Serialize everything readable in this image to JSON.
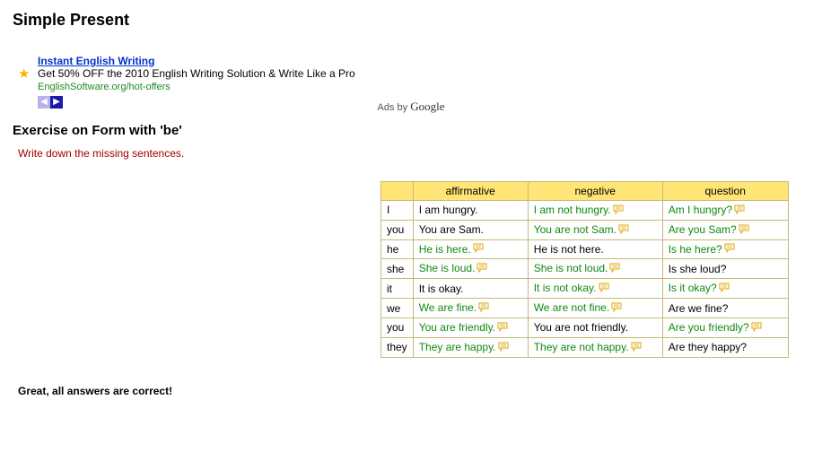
{
  "page_title": "Simple Present",
  "ad": {
    "title": "Instant English Writing",
    "body": "Get 50% OFF the 2010 English Writing Solution & Write Like a Pro",
    "url": "EnglishSoftware.org/hot-offers"
  },
  "ads_by_prefix": "Ads by ",
  "ads_by_brand": "Google",
  "subtitle": "Exercise on Form with 'be'",
  "instruction": "Write down the missing sentences.",
  "headers": {
    "affirmative": "affirmative",
    "negative": "negative",
    "question": "question"
  },
  "rows": [
    {
      "pron": "I",
      "aff": {
        "t": "I am hungry.",
        "ans": false,
        "b": false
      },
      "neg": {
        "t": "I am not hungry.",
        "ans": true,
        "b": true
      },
      "que": {
        "t": "Am I hungry?",
        "ans": true,
        "b": true
      }
    },
    {
      "pron": "you",
      "aff": {
        "t": "You are Sam.",
        "ans": false,
        "b": false
      },
      "neg": {
        "t": "You are not Sam.",
        "ans": true,
        "b": true
      },
      "que": {
        "t": "Are you Sam?",
        "ans": true,
        "b": true
      }
    },
    {
      "pron": "he",
      "aff": {
        "t": "He is here.",
        "ans": true,
        "b": true
      },
      "neg": {
        "t": "He is not here.",
        "ans": false,
        "b": false
      },
      "que": {
        "t": "Is he here?",
        "ans": true,
        "b": true
      }
    },
    {
      "pron": "she",
      "aff": {
        "t": "She is loud.",
        "ans": true,
        "b": true
      },
      "neg": {
        "t": "She is not loud.",
        "ans": true,
        "b": true
      },
      "que": {
        "t": "Is she loud?",
        "ans": false,
        "b": false
      }
    },
    {
      "pron": "it",
      "aff": {
        "t": "It is okay.",
        "ans": false,
        "b": false
      },
      "neg": {
        "t": "It is not okay.",
        "ans": true,
        "b": true
      },
      "que": {
        "t": "Is it okay?",
        "ans": true,
        "b": true
      }
    },
    {
      "pron": "we",
      "aff": {
        "t": "We are fine.",
        "ans": true,
        "b": true
      },
      "neg": {
        "t": "We are not fine.",
        "ans": true,
        "b": true
      },
      "que": {
        "t": "Are we fine?",
        "ans": false,
        "b": false
      }
    },
    {
      "pron": "you",
      "aff": {
        "t": "You are friendly.",
        "ans": true,
        "b": true
      },
      "neg": {
        "t": "You are not friendly.",
        "ans": false,
        "b": false
      },
      "que": {
        "t": "Are you friendly?",
        "ans": true,
        "b": true
      }
    },
    {
      "pron": "they",
      "aff": {
        "t": "They are happy.",
        "ans": true,
        "b": true
      },
      "neg": {
        "t": "They are not happy.",
        "ans": true,
        "b": true
      },
      "que": {
        "t": "Are they happy?",
        "ans": false,
        "b": false
      }
    }
  ],
  "result": "Great, all answers are correct!"
}
